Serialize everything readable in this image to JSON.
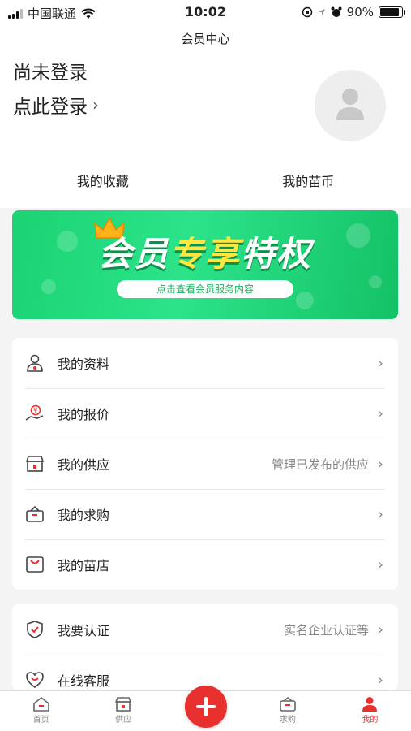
{
  "status_bar": {
    "carrier": "中国联通",
    "time": "10:02",
    "battery": "90%",
    "battery_level": 0.9
  },
  "header": {
    "title": "会员中心"
  },
  "profile": {
    "line1": "尚未登录",
    "login_link": "点此登录",
    "chevron": "›"
  },
  "quick_links": [
    {
      "label": "我的收藏"
    },
    {
      "label": "我的苗币"
    }
  ],
  "banner": {
    "title_part1": "会员",
    "title_part2": "专享",
    "title_part3": "特权",
    "subtitle": "点击查看会员服务内容"
  },
  "menu_group1": [
    {
      "label": "我的资料",
      "icon": "user-profile-icon",
      "right": ""
    },
    {
      "label": "我的报价",
      "icon": "quote-hand-icon",
      "right": ""
    },
    {
      "label": "我的供应",
      "icon": "store-icon",
      "right": "管理已发布的供应"
    },
    {
      "label": "我的求购",
      "icon": "basket-icon",
      "right": ""
    },
    {
      "label": "我的苗店",
      "icon": "shop-bag-icon",
      "right": ""
    }
  ],
  "menu_group2": [
    {
      "label": "我要认证",
      "icon": "shield-check-icon",
      "right": "实名企业认证等"
    },
    {
      "label": "在线客服",
      "icon": "customer-service-icon",
      "right": ""
    }
  ],
  "chevron": "›",
  "tabbar": {
    "items": [
      {
        "label": "首页",
        "icon": "home-icon"
      },
      {
        "label": "供应",
        "icon": "supply-store-icon"
      },
      {
        "label": "求购",
        "icon": "purchase-basket-icon"
      },
      {
        "label": "我的",
        "icon": "person-icon"
      }
    ],
    "active": "我的"
  },
  "colors": {
    "accent": "#e8302f",
    "banner_green": "#1bd373",
    "banner_yellow": "#ffe640"
  }
}
